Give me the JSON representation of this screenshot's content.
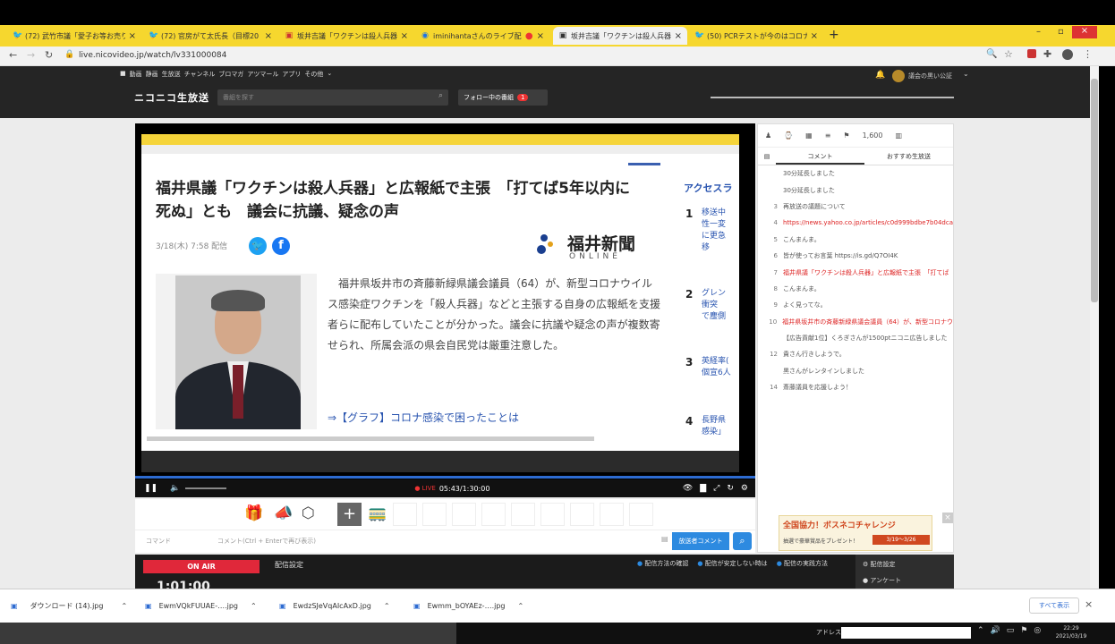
{
  "tabs": [
    {
      "label": "(72) 武竹市議「愛子お等お売り付",
      "icon": "twitter-icon"
    },
    {
      "label": "(72) 官房がて太氏長（目標20",
      "icon": "twitter-icon"
    },
    {
      "label": "坂井吉議「ワクチンは殺人兵器」に広",
      "icon": "nico-icon"
    },
    {
      "label": "iminihantaさんのライブ配信",
      "icon": "live-icon"
    },
    {
      "label": "坂井吉議「ワクチンは殺人兵器」に広",
      "icon": "nico-icon",
      "active": true
    },
    {
      "label": "(50) PCRテストが今のはコロナ封",
      "icon": "twitter-icon"
    }
  ],
  "address": "live.nicovideo.jp/watch/lv331000084",
  "nav": {
    "menu": [
      "動画",
      "静画",
      "生放送",
      "チャンネル",
      "ブロマガ",
      "アツマール",
      "アプリ",
      "その他"
    ],
    "logo": "ニコニコ生放送",
    "search_placeholder": "番組を探す",
    "follow_label": "フォロー中の番組",
    "follow_count": "1",
    "username": "議会の黒い公証"
  },
  "article": {
    "sidebar_title": "アクセスラ",
    "headline": "福井県議「ワクチンは殺人兵器」と広報紙で主張　「打てば5年以内に死ぬ」とも　議会に抗議、疑念の声",
    "date": "3/18(木) 7:58 配信",
    "logo_main": "福井新聞",
    "logo_sub": "ONLINE",
    "body": "福井県坂井市の斉藤新緑県議会議員（64）が、新型コロナウイルス感染症ワクチンを「殺人兵器」などと主張する自身の広報紙を支援者らに配布していたことが分かった。議会に抗議や疑念の声が複数寄せられ、所属会派の県会自民党は厳重注意した。",
    "link": "⇒【グラフ】コロナ感染で困ったことは",
    "ranking": [
      {
        "n": "1",
        "t": "移送中\n性一変\nに更急\n移"
      },
      {
        "n": "2",
        "t": "グレン\n衝突\nで塵側"
      },
      {
        "n": "3",
        "t": "英経率(\n個宣6人"
      },
      {
        "n": "4",
        "t": "長野県\n感染」"
      }
    ]
  },
  "player": {
    "live_label": "● LIVE",
    "time": "05:43/1:30:00"
  },
  "comments_panel": {
    "toolbar": [
      "1,600"
    ],
    "tabs": [
      "コメント",
      "おすすめ生放送"
    ],
    "rows": [
      {
        "n": "",
        "t": "30分延長しました",
        "red": false
      },
      {
        "n": "",
        "t": "30分延長しました",
        "red": false
      },
      {
        "n": "3",
        "t": "再放送の議題について",
        "red": false
      },
      {
        "n": "4",
        "t": "https://news.yahoo.co.jp/articles/c0d999bdbe7b04dca",
        "red": true
      },
      {
        "n": "5",
        "t": "こんまんま。",
        "red": false
      },
      {
        "n": "6",
        "t": "皆が使ってお言葉 https://is.gd/Q7OI4K",
        "red": false
      },
      {
        "n": "7",
        "t": "福井県議「ワクチンは殺人兵器」と広報紙で主張　「打てば",
        "red": true
      },
      {
        "n": "8",
        "t": "こんまんま。",
        "red": false
      },
      {
        "n": "9",
        "t": "よく見ってな。",
        "red": false
      },
      {
        "n": "10",
        "t": "福井県坂井市の斉藤新緑県議会議員（64）が、新型コロナウ",
        "red": true
      },
      {
        "n": "",
        "t": "【広告貢献1位】くろぎさんが1500ptニコニ広告しました",
        "red": false
      },
      {
        "n": "12",
        "t": "貴さん行きしようで。",
        "red": false
      },
      {
        "n": "",
        "t": "黒さんがレンタインしました",
        "red": false
      },
      {
        "n": "14",
        "t": "斎藤議員を応援しよう！",
        "red": false
      }
    ]
  },
  "cmd": {
    "label": "コマンド",
    "placeholder": "コメント(Ctrl + Enterで再び表示)",
    "send": "放送者コメント"
  },
  "ad": {
    "title": "全国協力！ボスネコチャレンジ",
    "sub": "抽選で豪華賞品をプレゼント！",
    "dates": "3/19～3/26"
  },
  "bottom": {
    "onair": "ON AIR",
    "time": "1:01:00",
    "settings": "配信設定",
    "help1": "配信方法の確認",
    "help2": "配信が安定しない時は",
    "help3": "配信の実践方法",
    "menu1": "配信設定",
    "menu2": "アンケート"
  },
  "downloads": [
    {
      "name": "ダウンロード (14).jpg"
    },
    {
      "name": "EwmVQkFUUAE-….jpg"
    },
    {
      "name": "EwdzSJeVqAIcAxD.jpg"
    },
    {
      "name": "Ewmm_bOYAEz-….jpg"
    }
  ],
  "download_all": "すべて表示",
  "taskbar": {
    "address_label": "アドレス",
    "time": "22:29",
    "date": "2021/03/19"
  }
}
